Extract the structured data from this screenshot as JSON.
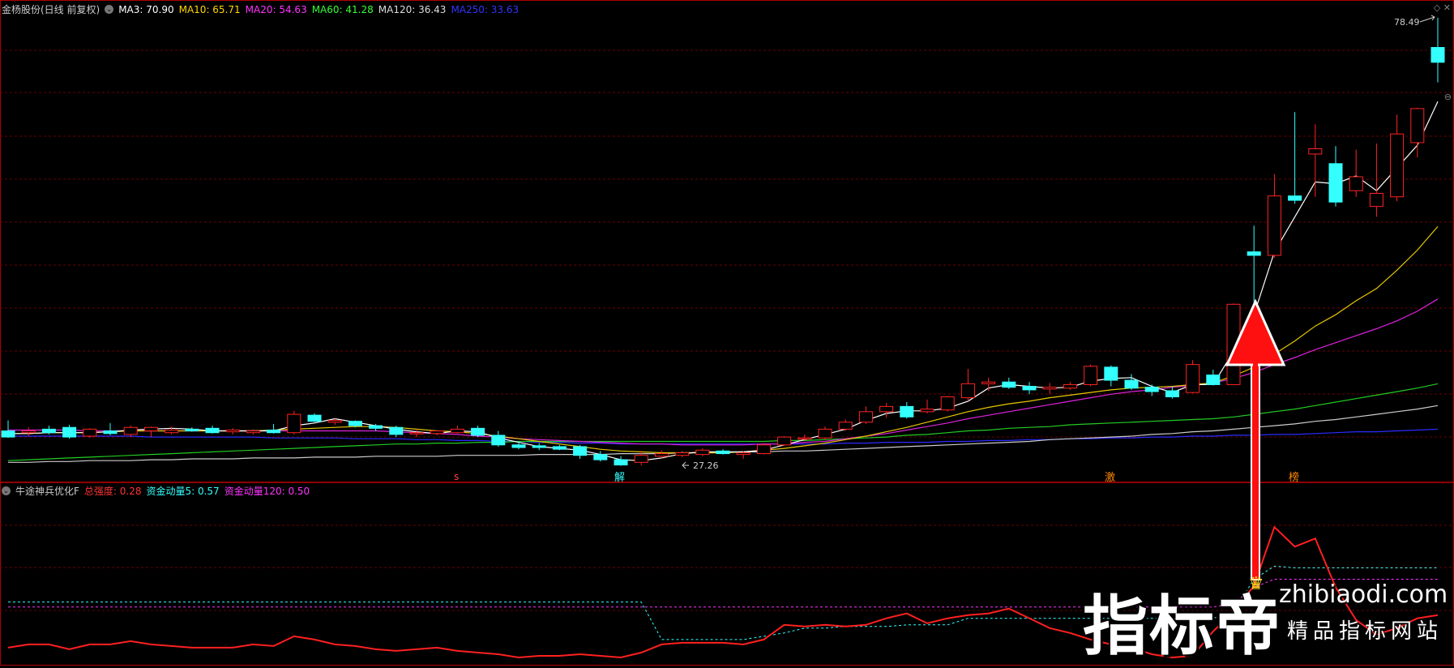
{
  "main_panel": {
    "title": "金杨股份(日线 前复权)",
    "ma_items": [
      {
        "label": "MA3: 70.90",
        "color": "#ffffff"
      },
      {
        "label": "MA10: 65.71",
        "color": "#ffd700"
      },
      {
        "label": "MA20: 54.63",
        "color": "#ff33ff"
      },
      {
        "label": "MA60: 41.28",
        "color": "#33ff33"
      },
      {
        "label": "MA120: 36.43",
        "color": "#dddddd"
      },
      {
        "label": "MA250: 33.63",
        "color": "#3333ff"
      }
    ],
    "high_label": "78.49",
    "low_label": "27.26",
    "signal_marks": [
      {
        "text": "s",
        "color": "#ff4444"
      },
      {
        "text": "解",
        "color": "#33ffff"
      },
      {
        "text": "激",
        "color": "#ff8800"
      },
      {
        "text": "榜",
        "color": "#ff8800"
      }
    ]
  },
  "indicator_panel": {
    "title": "牛途神兵优化F",
    "items": [
      {
        "label": "总强度: 0.28",
        "color": "#ff3333"
      },
      {
        "label": "资金动量5: 0.57",
        "color": "#33ffff"
      },
      {
        "label": "资金动量120: 0.50",
        "color": "#ff33ff"
      }
    ]
  },
  "watermark": {
    "brand": "指标帝",
    "url": "zhibiaodi.com",
    "slogan": "精品指标网站"
  },
  "chart_data": {
    "type": "candlestick",
    "price_range": [
      27.26,
      78.49
    ],
    "candles": [
      {
        "o": 31.2,
        "h": 32.4,
        "l": 30.4,
        "c": 30.5
      },
      {
        "o": 31.0,
        "h": 31.6,
        "l": 30.6,
        "c": 31.2
      },
      {
        "o": 31.4,
        "h": 31.8,
        "l": 30.8,
        "c": 31.0
      },
      {
        "o": 31.6,
        "h": 31.9,
        "l": 30.3,
        "c": 30.5
      },
      {
        "o": 30.6,
        "h": 31.5,
        "l": 30.4,
        "c": 31.4
      },
      {
        "o": 31.2,
        "h": 32.1,
        "l": 30.7,
        "c": 30.9
      },
      {
        "o": 30.8,
        "h": 31.8,
        "l": 30.5,
        "c": 31.6
      },
      {
        "o": 31.2,
        "h": 31.7,
        "l": 30.5,
        "c": 31.6
      },
      {
        "o": 31.0,
        "h": 31.7,
        "l": 30.8,
        "c": 31.3
      },
      {
        "o": 31.4,
        "h": 31.6,
        "l": 31.1,
        "c": 31.2
      },
      {
        "o": 31.5,
        "h": 31.8,
        "l": 30.9,
        "c": 31.0
      },
      {
        "o": 31.1,
        "h": 31.5,
        "l": 30.8,
        "c": 31.3
      },
      {
        "o": 31.0,
        "h": 31.4,
        "l": 30.8,
        "c": 31.2
      },
      {
        "o": 31.3,
        "h": 32.0,
        "l": 30.9,
        "c": 31.0
      },
      {
        "o": 31.0,
        "h": 33.5,
        "l": 30.8,
        "c": 33.1
      },
      {
        "o": 33.0,
        "h": 33.2,
        "l": 32.2,
        "c": 32.3
      },
      {
        "o": 32.2,
        "h": 32.6,
        "l": 31.9,
        "c": 32.4
      },
      {
        "o": 32.3,
        "h": 32.4,
        "l": 31.6,
        "c": 31.8
      },
      {
        "o": 31.8,
        "h": 32.0,
        "l": 31.2,
        "c": 31.5
      },
      {
        "o": 31.6,
        "h": 31.8,
        "l": 30.5,
        "c": 30.8
      },
      {
        "o": 30.9,
        "h": 31.4,
        "l": 30.5,
        "c": 31.0
      },
      {
        "o": 30.9,
        "h": 31.3,
        "l": 30.7,
        "c": 31.2
      },
      {
        "o": 31.0,
        "h": 31.8,
        "l": 30.9,
        "c": 31.4
      },
      {
        "o": 31.5,
        "h": 31.8,
        "l": 30.5,
        "c": 30.7
      },
      {
        "o": 30.7,
        "h": 31.2,
        "l": 29.4,
        "c": 29.6
      },
      {
        "o": 29.6,
        "h": 29.9,
        "l": 29.1,
        "c": 29.3
      },
      {
        "o": 29.5,
        "h": 29.8,
        "l": 29.0,
        "c": 29.3
      },
      {
        "o": 29.4,
        "h": 29.6,
        "l": 29.0,
        "c": 29.1
      },
      {
        "o": 29.4,
        "h": 29.6,
        "l": 28.0,
        "c": 28.4
      },
      {
        "o": 28.5,
        "h": 28.9,
        "l": 27.7,
        "c": 27.9
      },
      {
        "o": 27.9,
        "h": 28.3,
        "l": 27.2,
        "c": 27.3
      },
      {
        "o": 27.6,
        "h": 28.9,
        "l": 27.26,
        "c": 28.4
      },
      {
        "o": 28.3,
        "h": 29.0,
        "l": 28.0,
        "c": 28.6
      },
      {
        "o": 28.4,
        "h": 28.9,
        "l": 28.2,
        "c": 28.7
      },
      {
        "o": 28.5,
        "h": 29.2,
        "l": 28.3,
        "c": 29.0
      },
      {
        "o": 28.9,
        "h": 29.1,
        "l": 28.5,
        "c": 28.6
      },
      {
        "o": 28.5,
        "h": 28.9,
        "l": 28.0,
        "c": 28.7
      },
      {
        "o": 28.6,
        "h": 29.8,
        "l": 28.5,
        "c": 29.6
      },
      {
        "o": 29.6,
        "h": 30.6,
        "l": 29.5,
        "c": 30.5
      },
      {
        "o": 30.4,
        "h": 30.8,
        "l": 30.1,
        "c": 30.4
      },
      {
        "o": 30.4,
        "h": 31.7,
        "l": 30.2,
        "c": 31.4
      },
      {
        "o": 31.4,
        "h": 32.5,
        "l": 31.2,
        "c": 32.2
      },
      {
        "o": 32.2,
        "h": 34.0,
        "l": 32.0,
        "c": 33.4
      },
      {
        "o": 33.4,
        "h": 34.4,
        "l": 32.7,
        "c": 34.0
      },
      {
        "o": 34.0,
        "h": 34.5,
        "l": 32.6,
        "c": 32.8
      },
      {
        "o": 33.4,
        "h": 34.8,
        "l": 33.2,
        "c": 33.7
      },
      {
        "o": 33.6,
        "h": 35.2,
        "l": 33.4,
        "c": 35.1
      },
      {
        "o": 35.0,
        "h": 38.3,
        "l": 34.6,
        "c": 36.6
      },
      {
        "o": 36.6,
        "h": 37.3,
        "l": 35.8,
        "c": 36.8
      },
      {
        "o": 36.8,
        "h": 37.3,
        "l": 36.0,
        "c": 36.2
      },
      {
        "o": 36.3,
        "h": 36.8,
        "l": 35.4,
        "c": 35.9
      },
      {
        "o": 36.0,
        "h": 36.7,
        "l": 35.4,
        "c": 36.2
      },
      {
        "o": 36.1,
        "h": 36.8,
        "l": 35.9,
        "c": 36.5
      },
      {
        "o": 36.5,
        "h": 38.8,
        "l": 36.3,
        "c": 38.6
      },
      {
        "o": 38.5,
        "h": 38.7,
        "l": 36.3,
        "c": 37.0
      },
      {
        "o": 37.0,
        "h": 37.7,
        "l": 35.9,
        "c": 36.1
      },
      {
        "o": 36.2,
        "h": 36.5,
        "l": 35.2,
        "c": 35.7
      },
      {
        "o": 35.8,
        "h": 36.3,
        "l": 34.9,
        "c": 35.1
      },
      {
        "o": 35.6,
        "h": 39.3,
        "l": 35.5,
        "c": 38.8
      },
      {
        "o": 37.6,
        "h": 38.2,
        "l": 36.4,
        "c": 36.5
      },
      {
        "o": 36.5,
        "h": 45.8,
        "l": 36.5,
        "c": 45.7
      },
      {
        "o": 51.7,
        "h": 54.7,
        "l": 43.5,
        "c": 51.3
      },
      {
        "o": 51.3,
        "h": 60.6,
        "l": 51.0,
        "c": 58.1
      },
      {
        "o": 58.1,
        "h": 67.7,
        "l": 57.2,
        "c": 57.6
      },
      {
        "o": 62.9,
        "h": 66.3,
        "l": 58.0,
        "c": 63.5
      },
      {
        "o": 61.8,
        "h": 63.8,
        "l": 56.9,
        "c": 57.4
      },
      {
        "o": 58.7,
        "h": 63.4,
        "l": 58.0,
        "c": 60.3
      },
      {
        "o": 56.9,
        "h": 64.1,
        "l": 55.7,
        "c": 58.4
      },
      {
        "o": 58.0,
        "h": 67.4,
        "l": 57.5,
        "c": 65.2
      },
      {
        "o": 64.2,
        "h": 68.2,
        "l": 62.5,
        "c": 68.1
      },
      {
        "o": 75.1,
        "h": 78.5,
        "l": 71.1,
        "c": 73.4
      }
    ],
    "ma3": [
      30.9,
      30.9,
      31.0,
      31.0,
      31.0,
      31.1,
      31.3,
      31.4,
      31.5,
      31.4,
      31.2,
      31.2,
      31.2,
      31.2,
      31.8,
      32.1,
      32.6,
      32.2,
      31.8,
      31.4,
      31.1,
      30.9,
      31.2,
      31.1,
      30.4,
      29.9,
      29.4,
      29.2,
      29.0,
      28.5,
      27.9,
      27.8,
      28.1,
      28.6,
      28.8,
      28.8,
      28.8,
      29.0,
      29.6,
      30.2,
      30.8,
      31.4,
      32.4,
      33.2,
      33.5,
      33.5,
      33.8,
      34.6,
      36.1,
      36.5,
      36.3,
      36.1,
      36.2,
      36.9,
      37.2,
      37.3,
      36.3,
      35.6,
      36.5,
      36.5,
      40.3,
      44.5,
      51.7,
      55.7,
      59.7,
      59.5,
      60.4,
      58.7,
      61.3,
      63.9,
      68.9
    ],
    "ma10": [
      30.9,
      30.9,
      31.0,
      31.0,
      31.0,
      31.1,
      31.2,
      31.2,
      31.2,
      31.2,
      31.2,
      31.2,
      31.2,
      31.3,
      31.4,
      31.5,
      31.6,
      31.7,
      31.7,
      31.6,
      31.4,
      31.2,
      31.1,
      30.9,
      30.6,
      30.3,
      30.0,
      29.7,
      29.4,
      29.1,
      28.9,
      28.8,
      28.7,
      28.7,
      28.7,
      28.7,
      28.8,
      29.0,
      29.2,
      29.5,
      29.8,
      30.2,
      30.6,
      31.1,
      31.6,
      32.2,
      32.8,
      33.4,
      33.9,
      34.3,
      34.6,
      35.0,
      35.3,
      35.6,
      35.9,
      36.1,
      36.2,
      36.3,
      36.5,
      36.7,
      37.5,
      38.5,
      40.0,
      41.5,
      43.2,
      44.5,
      46.1,
      47.5,
      49.6,
      51.9,
      54.6
    ],
    "ma20": [
      31.3,
      31.3,
      31.3,
      31.3,
      31.2,
      31.2,
      31.2,
      31.2,
      31.2,
      31.2,
      31.2,
      31.2,
      31.2,
      31.2,
      31.2,
      31.2,
      31.2,
      31.2,
      31.2,
      31.1,
      31.0,
      30.9,
      30.8,
      30.6,
      30.5,
      30.3,
      30.2,
      30.1,
      30.0,
      29.9,
      29.8,
      29.7,
      29.7,
      29.6,
      29.6,
      29.6,
      29.6,
      29.7,
      29.7,
      29.9,
      30.0,
      30.3,
      30.6,
      30.9,
      31.3,
      31.7,
      32.1,
      32.6,
      33.0,
      33.4,
      33.8,
      34.2,
      34.6,
      35.0,
      35.4,
      35.7,
      35.9,
      36.2,
      36.4,
      36.7,
      37.2,
      37.9,
      38.8,
      39.6,
      40.5,
      41.3,
      42.1,
      42.9,
      43.8,
      44.9,
      46.3
    ],
    "ma60": [
      27.8,
      27.9,
      28.0,
      28.1,
      28.2,
      28.3,
      28.4,
      28.5,
      28.6,
      28.7,
      28.8,
      28.9,
      29.0,
      29.1,
      29.2,
      29.3,
      29.4,
      29.5,
      29.6,
      29.7,
      29.7,
      29.8,
      29.8,
      29.9,
      29.9,
      30.0,
      30.0,
      30.0,
      30.0,
      30.0,
      30.0,
      30.0,
      30.0,
      30.0,
      30.0,
      30.0,
      30.0,
      30.0,
      30.1,
      30.1,
      30.2,
      30.3,
      30.4,
      30.5,
      30.7,
      30.8,
      31.0,
      31.2,
      31.3,
      31.5,
      31.6,
      31.7,
      31.9,
      32.0,
      32.1,
      32.2,
      32.3,
      32.4,
      32.5,
      32.6,
      32.8,
      33.1,
      33.4,
      33.7,
      34.1,
      34.5,
      34.9,
      35.3,
      35.7,
      36.1,
      36.6
    ],
    "ma120": [
      27.6,
      27.6,
      27.7,
      27.7,
      27.8,
      27.8,
      27.8,
      27.9,
      27.9,
      28.0,
      28.0,
      28.0,
      28.1,
      28.1,
      28.1,
      28.2,
      28.2,
      28.2,
      28.3,
      28.3,
      28.3,
      28.3,
      28.4,
      28.4,
      28.4,
      28.4,
      28.5,
      28.5,
      28.5,
      28.5,
      28.6,
      28.6,
      28.6,
      28.7,
      28.7,
      28.7,
      28.8,
      28.8,
      28.9,
      28.9,
      29.0,
      29.1,
      29.2,
      29.3,
      29.4,
      29.5,
      29.6,
      29.7,
      29.8,
      29.9,
      30.0,
      30.2,
      30.3,
      30.4,
      30.5,
      30.6,
      30.8,
      30.9,
      31.1,
      31.2,
      31.4,
      31.6,
      31.8,
      32.0,
      32.3,
      32.5,
      32.8,
      33.1,
      33.4,
      33.7,
      34.1
    ],
    "ma250": [
      30.6,
      30.6,
      30.6,
      30.6,
      30.6,
      30.6,
      30.6,
      30.5,
      30.5,
      30.5,
      30.5,
      30.5,
      30.5,
      30.4,
      30.4,
      30.4,
      30.4,
      30.3,
      30.3,
      30.3,
      30.2,
      30.2,
      30.1,
      30.1,
      30.0,
      30.0,
      29.9,
      29.9,
      29.8,
      29.8,
      29.7,
      29.7,
      29.7,
      29.7,
      29.7,
      29.7,
      29.7,
      29.7,
      29.7,
      29.7,
      29.7,
      29.8,
      29.8,
      29.9,
      29.9,
      29.9,
      30.0,
      30.0,
      30.1,
      30.1,
      30.2,
      30.2,
      30.3,
      30.3,
      30.4,
      30.4,
      30.5,
      30.5,
      30.6,
      30.6,
      30.7,
      30.7,
      30.8,
      30.8,
      30.9,
      31.0,
      31.1,
      31.1,
      31.2,
      31.3,
      31.4
    ],
    "indicator": {
      "range": [
        0,
        1
      ],
      "total_strength": [
        0.08,
        0.1,
        0.1,
        0.07,
        0.1,
        0.1,
        0.12,
        0.1,
        0.09,
        0.08,
        0.08,
        0.08,
        0.1,
        0.09,
        0.15,
        0.13,
        0.1,
        0.09,
        0.07,
        0.06,
        0.07,
        0.08,
        0.06,
        0.05,
        0.04,
        0.02,
        0.03,
        0.03,
        0.04,
        0.03,
        0.02,
        0.05,
        0.1,
        0.11,
        0.11,
        0.11,
        0.1,
        0.13,
        0.22,
        0.21,
        0.22,
        0.21,
        0.22,
        0.26,
        0.29,
        0.23,
        0.26,
        0.28,
        0.29,
        0.32,
        0.26,
        0.2,
        0.17,
        0.13,
        0.1,
        0.08,
        0.04,
        0.02,
        0.03,
        0.18,
        0.3,
        0.46,
        0.82,
        0.7,
        0.75,
        0.45,
        0.25,
        0.16,
        0.2,
        0.26,
        0.28
      ],
      "fund_momentum_5": [
        0.36,
        0.36,
        0.36,
        0.36,
        0.36,
        0.36,
        0.36,
        0.36,
        0.36,
        0.36,
        0.36,
        0.36,
        0.36,
        0.36,
        0.36,
        0.36,
        0.36,
        0.36,
        0.36,
        0.36,
        0.36,
        0.36,
        0.36,
        0.36,
        0.36,
        0.36,
        0.36,
        0.36,
        0.36,
        0.36,
        0.36,
        0.36,
        0.13,
        0.13,
        0.13,
        0.13,
        0.13,
        0.15,
        0.17,
        0.2,
        0.2,
        0.21,
        0.21,
        0.21,
        0.22,
        0.22,
        0.22,
        0.26,
        0.26,
        0.26,
        0.26,
        0.26,
        0.26,
        0.26,
        0.26,
        0.26,
        0.26,
        0.26,
        0.26,
        0.26,
        0.3,
        0.5,
        0.58,
        0.57,
        0.57,
        0.57,
        0.57,
        0.57,
        0.57,
        0.57,
        0.57
      ],
      "fund_momentum_120": [
        0.33,
        0.33,
        0.33,
        0.33,
        0.33,
        0.33,
        0.33,
        0.33,
        0.33,
        0.33,
        0.33,
        0.33,
        0.33,
        0.33,
        0.33,
        0.33,
        0.33,
        0.33,
        0.33,
        0.33,
        0.33,
        0.33,
        0.33,
        0.33,
        0.33,
        0.33,
        0.33,
        0.33,
        0.33,
        0.33,
        0.33,
        0.33,
        0.33,
        0.33,
        0.33,
        0.33,
        0.33,
        0.33,
        0.33,
        0.33,
        0.33,
        0.33,
        0.33,
        0.33,
        0.33,
        0.33,
        0.33,
        0.33,
        0.33,
        0.33,
        0.33,
        0.33,
        0.33,
        0.33,
        0.33,
        0.33,
        0.33,
        0.33,
        0.33,
        0.33,
        0.35,
        0.45,
        0.5,
        0.5,
        0.5,
        0.5,
        0.5,
        0.5,
        0.5,
        0.5,
        0.5
      ]
    }
  }
}
